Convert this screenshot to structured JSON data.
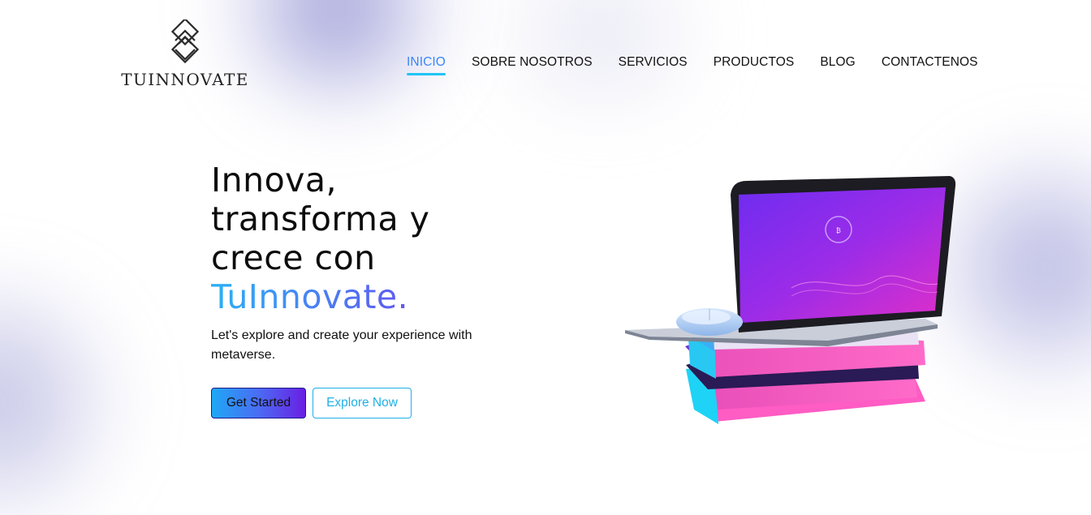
{
  "brand": {
    "name": "TUINNOVATE"
  },
  "nav": {
    "items": [
      {
        "label": "INICIO",
        "active": true
      },
      {
        "label": "SOBRE NOSOTROS",
        "active": false
      },
      {
        "label": "SERVICIOS",
        "active": false
      },
      {
        "label": "PRODUCTOS",
        "active": false
      },
      {
        "label": "BLOG",
        "active": false
      },
      {
        "label": "CONTACTENOS",
        "active": false
      }
    ]
  },
  "hero": {
    "headline_lines": [
      "Innova,",
      "transforma y",
      "crece con"
    ],
    "headline_brand": "TuInnovate.",
    "subtext": "Let's explore and create your experience with metaverse.",
    "primary_button": "Get Started",
    "secondary_button": "Explore Now"
  },
  "colors": {
    "accent": "#20c4f4",
    "active_nav": "#3a86f7",
    "gradient_start": "#2bb1f5",
    "gradient_end": "#8a2be2"
  }
}
